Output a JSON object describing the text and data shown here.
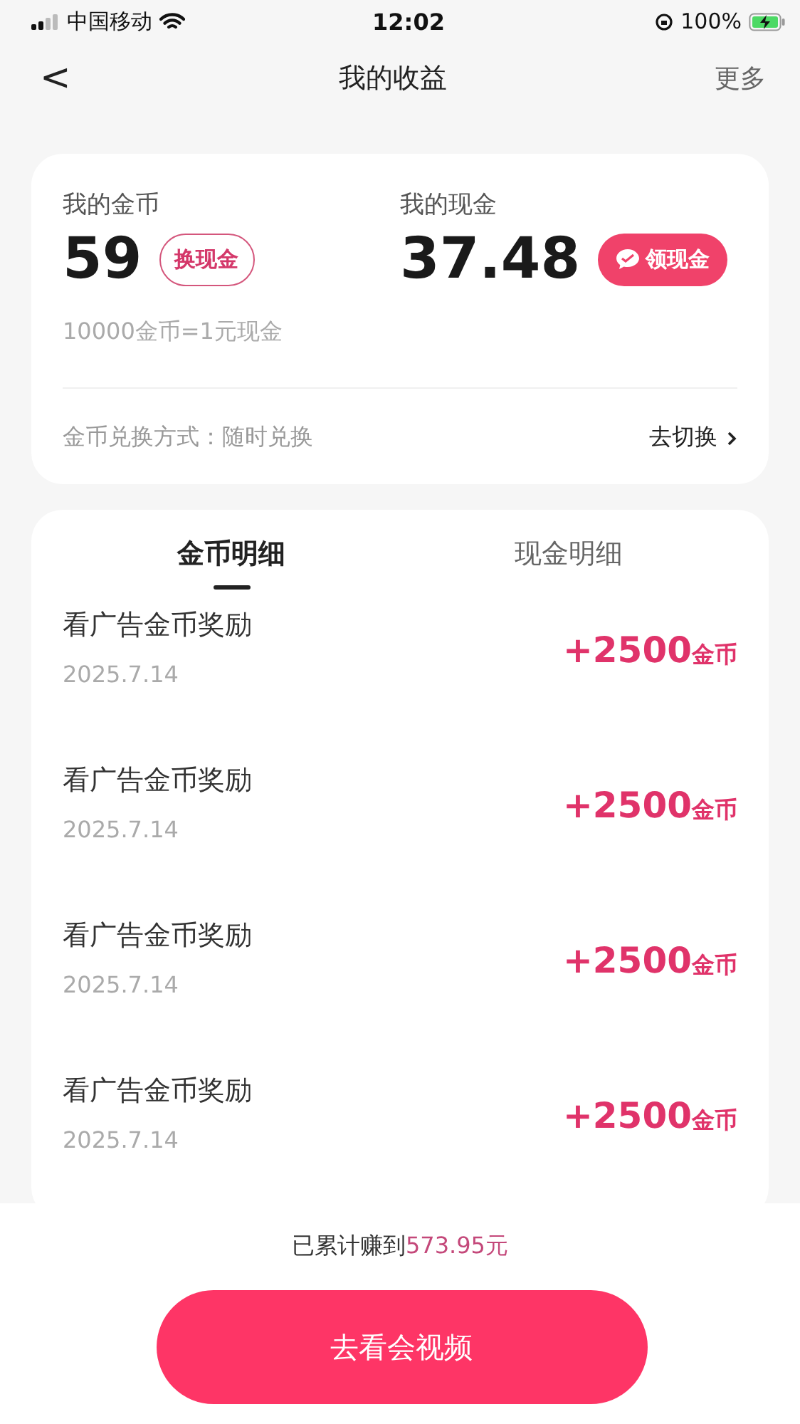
{
  "status_bar": {
    "carrier": "中国移动",
    "time": "12:02",
    "battery": "100%"
  },
  "nav": {
    "back": "<",
    "title": "我的收益",
    "more": "更多"
  },
  "summary": {
    "coins_label": "我的金币",
    "coins": "59",
    "exchange_button": "换现金",
    "cash_label": "我的现金",
    "cash": "37.48",
    "withdraw_button": "领现金",
    "rate": "10000金币=1元现金",
    "method_label": "金币兑换方式：随时兑换",
    "switch_link": "去切换"
  },
  "tabs": [
    {
      "label": "金币明细",
      "selected": true
    },
    {
      "label": "现金明细",
      "selected": false
    }
  ],
  "records": [
    {
      "title": "看广告金币奖励",
      "date": "2025.7.14",
      "amount": "+2500",
      "unit": "金币"
    },
    {
      "title": "看广告金币奖励",
      "date": "2025.7.14",
      "amount": "+2500",
      "unit": "金币"
    },
    {
      "title": "看广告金币奖励",
      "date": "2025.7.14",
      "amount": "+2500",
      "unit": "金币"
    },
    {
      "title": "看广告金币奖励",
      "date": "2025.7.14",
      "amount": "+2500",
      "unit": "金币"
    }
  ],
  "footer": {
    "total_label": "已累计赚到",
    "total": "573.95元",
    "action_button": "去看会视频"
  }
}
